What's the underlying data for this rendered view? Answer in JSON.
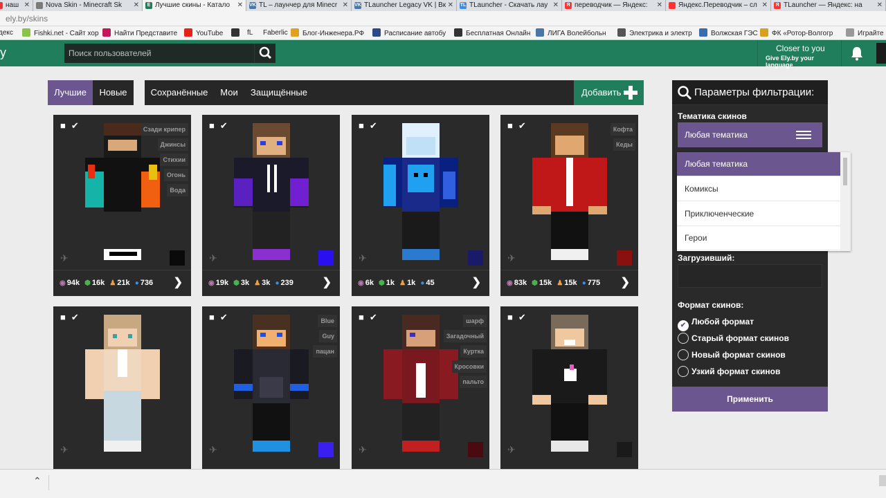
{
  "tabs": [
    {
      "label": "наш",
      "close": "✕"
    },
    {
      "label": "Nova Skin - Minecraft Sk",
      "close": "✕"
    },
    {
      "label": "Лучшие скины - Катало",
      "close": "✕"
    },
    {
      "label": "TL – лаунчер для Minecr",
      "close": "✕"
    },
    {
      "label": "TLauncher Legacy VK | Вк",
      "close": "✕"
    },
    {
      "label": "TLauncher - Скачать лау",
      "close": "✕"
    },
    {
      "label": "переводчик — Яндекс:",
      "close": "✕"
    },
    {
      "label": "Яндекс.Переводчик – сл",
      "close": "✕"
    },
    {
      "label": "TLauncher — Яндекс: на",
      "close": "✕"
    }
  ],
  "address": "ely.by/skins",
  "bookmarks": [
    "декс",
    "Fishki.net - Сайт хор",
    "Найти Представите",
    "YouTube",
    "",
    "fL",
    "Faberlic",
    "Блог-Инженера.РФ",
    "Расписание автобу",
    "Бесплатная Онлайн",
    "ЛИГА Волейбольн",
    "Электрика и электр",
    "Волжская ГЭС",
    "ФК «Ротор-Волгогр",
    "Играйте в"
  ],
  "header": {
    "search_placeholder": "Поиск пользователей",
    "lang_title": "Closer to you",
    "lang_sub": "Give Ely.by your language"
  },
  "tabs_left": [
    "Лучшие",
    "Новые"
  ],
  "tabs_right": [
    "Сохранённые",
    "Мои",
    "Защищённые"
  ],
  "add_label": "Добавить",
  "colors": {
    "green": "#207e5c",
    "purple": "#6b568f",
    "card": "#2a2a2a"
  },
  "cards": [
    {
      "tags": [
        "Сзади крипер",
        "Джинсы",
        "Стихии",
        "Огонь",
        "Вода"
      ],
      "views": "94k",
      "downloads": "16k",
      "likes": "21k",
      "comments": "736",
      "swatch": "#0a0a0a"
    },
    {
      "tags": [],
      "views": "19k",
      "downloads": "3k",
      "likes": "3k",
      "comments": "239",
      "swatch": "#2a10f0"
    },
    {
      "tags": [],
      "views": "6k",
      "downloads": "1k",
      "likes": "1k",
      "comments": "45",
      "swatch": "#1a1a6a"
    },
    {
      "tags": [
        "Кофта",
        "Кеды"
      ],
      "views": "83k",
      "downloads": "15k",
      "likes": "15k",
      "comments": "775",
      "swatch": "#8a1010"
    },
    {
      "tags": [],
      "swatch": ""
    },
    {
      "tags": [
        "Blue",
        "Guy",
        "пацан"
      ],
      "swatch": "#3a20f0"
    },
    {
      "tags": [
        "шарф",
        "Загадочный",
        "Куртка",
        "Кросовки",
        "пальто"
      ],
      "swatch": "#4a0a10"
    },
    {
      "tags": [],
      "swatch": "#1a1a1a"
    }
  ],
  "filter": {
    "title": "Параметры фильтрации:",
    "theme_label": "Тематика скинов",
    "theme_value": "Любая тематика",
    "uploader_label": "Загрузивший:",
    "format_label": "Формат скинов:",
    "formats": [
      "Любой формат",
      "Старый формат скинов",
      "Новый формат скинов",
      "Узкий формат скинов"
    ],
    "apply": "Применить"
  },
  "dropdown": [
    "Любая тематика",
    "Комиксы",
    "Приключенческие",
    "Герои"
  ]
}
